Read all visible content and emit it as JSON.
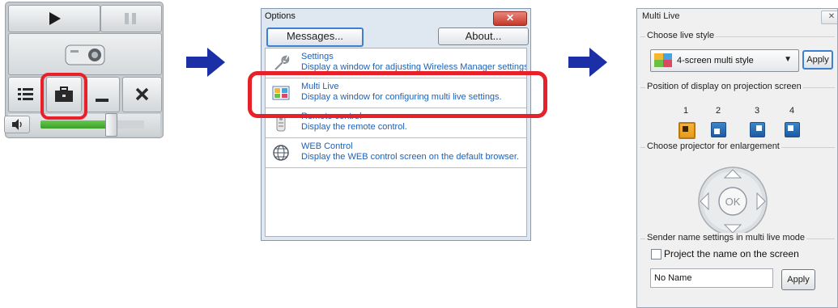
{
  "controller": {
    "play_icon": "play-icon",
    "pause_icon": "pause-icon",
    "projector_icon": "projector-icon",
    "tools": [
      "list-icon",
      "toolbox-icon",
      "minimize-icon",
      "close-icon"
    ],
    "volume_icon": "speaker-icon",
    "volume_level": 0.72
  },
  "options": {
    "title": "Options",
    "close_label": "✕",
    "messages_button": "Messages...",
    "about_button": "About...",
    "items": [
      {
        "icon": "wrench-icon",
        "title": "Settings",
        "description": "Display a window for adjusting Wireless Manager settings."
      },
      {
        "icon": "multi-live-icon",
        "title": "Multi Live",
        "description": "Display a window for configuring multi live settings."
      },
      {
        "icon": "remote-icon",
        "title": "Remote control",
        "description": "Display the remote control."
      },
      {
        "icon": "globe-icon",
        "title": "WEB Control",
        "description": "Display the WEB control screen on the default browser."
      }
    ]
  },
  "multi_live": {
    "title": "Multi Live",
    "close_label": "✕",
    "choose_style_label": "Choose live style",
    "style_value": "4-screen multi style",
    "apply_label": "Apply",
    "position_label": "Position of display on projection screen",
    "positions": [
      "1",
      "2",
      "3",
      "4"
    ],
    "selected_position": "1",
    "enlarge_label": "Choose projector for enlargement",
    "ok_label": "OK",
    "sender_label": "Sender name settings in multi live mode",
    "project_name_label": "Project the name on the screen",
    "project_name_checked": false,
    "name_value": "No Name",
    "apply2_label": "Apply"
  },
  "colors": {
    "highlight": "#e8202a",
    "arrow": "#1b2fa6",
    "link": "#1c62b9"
  }
}
